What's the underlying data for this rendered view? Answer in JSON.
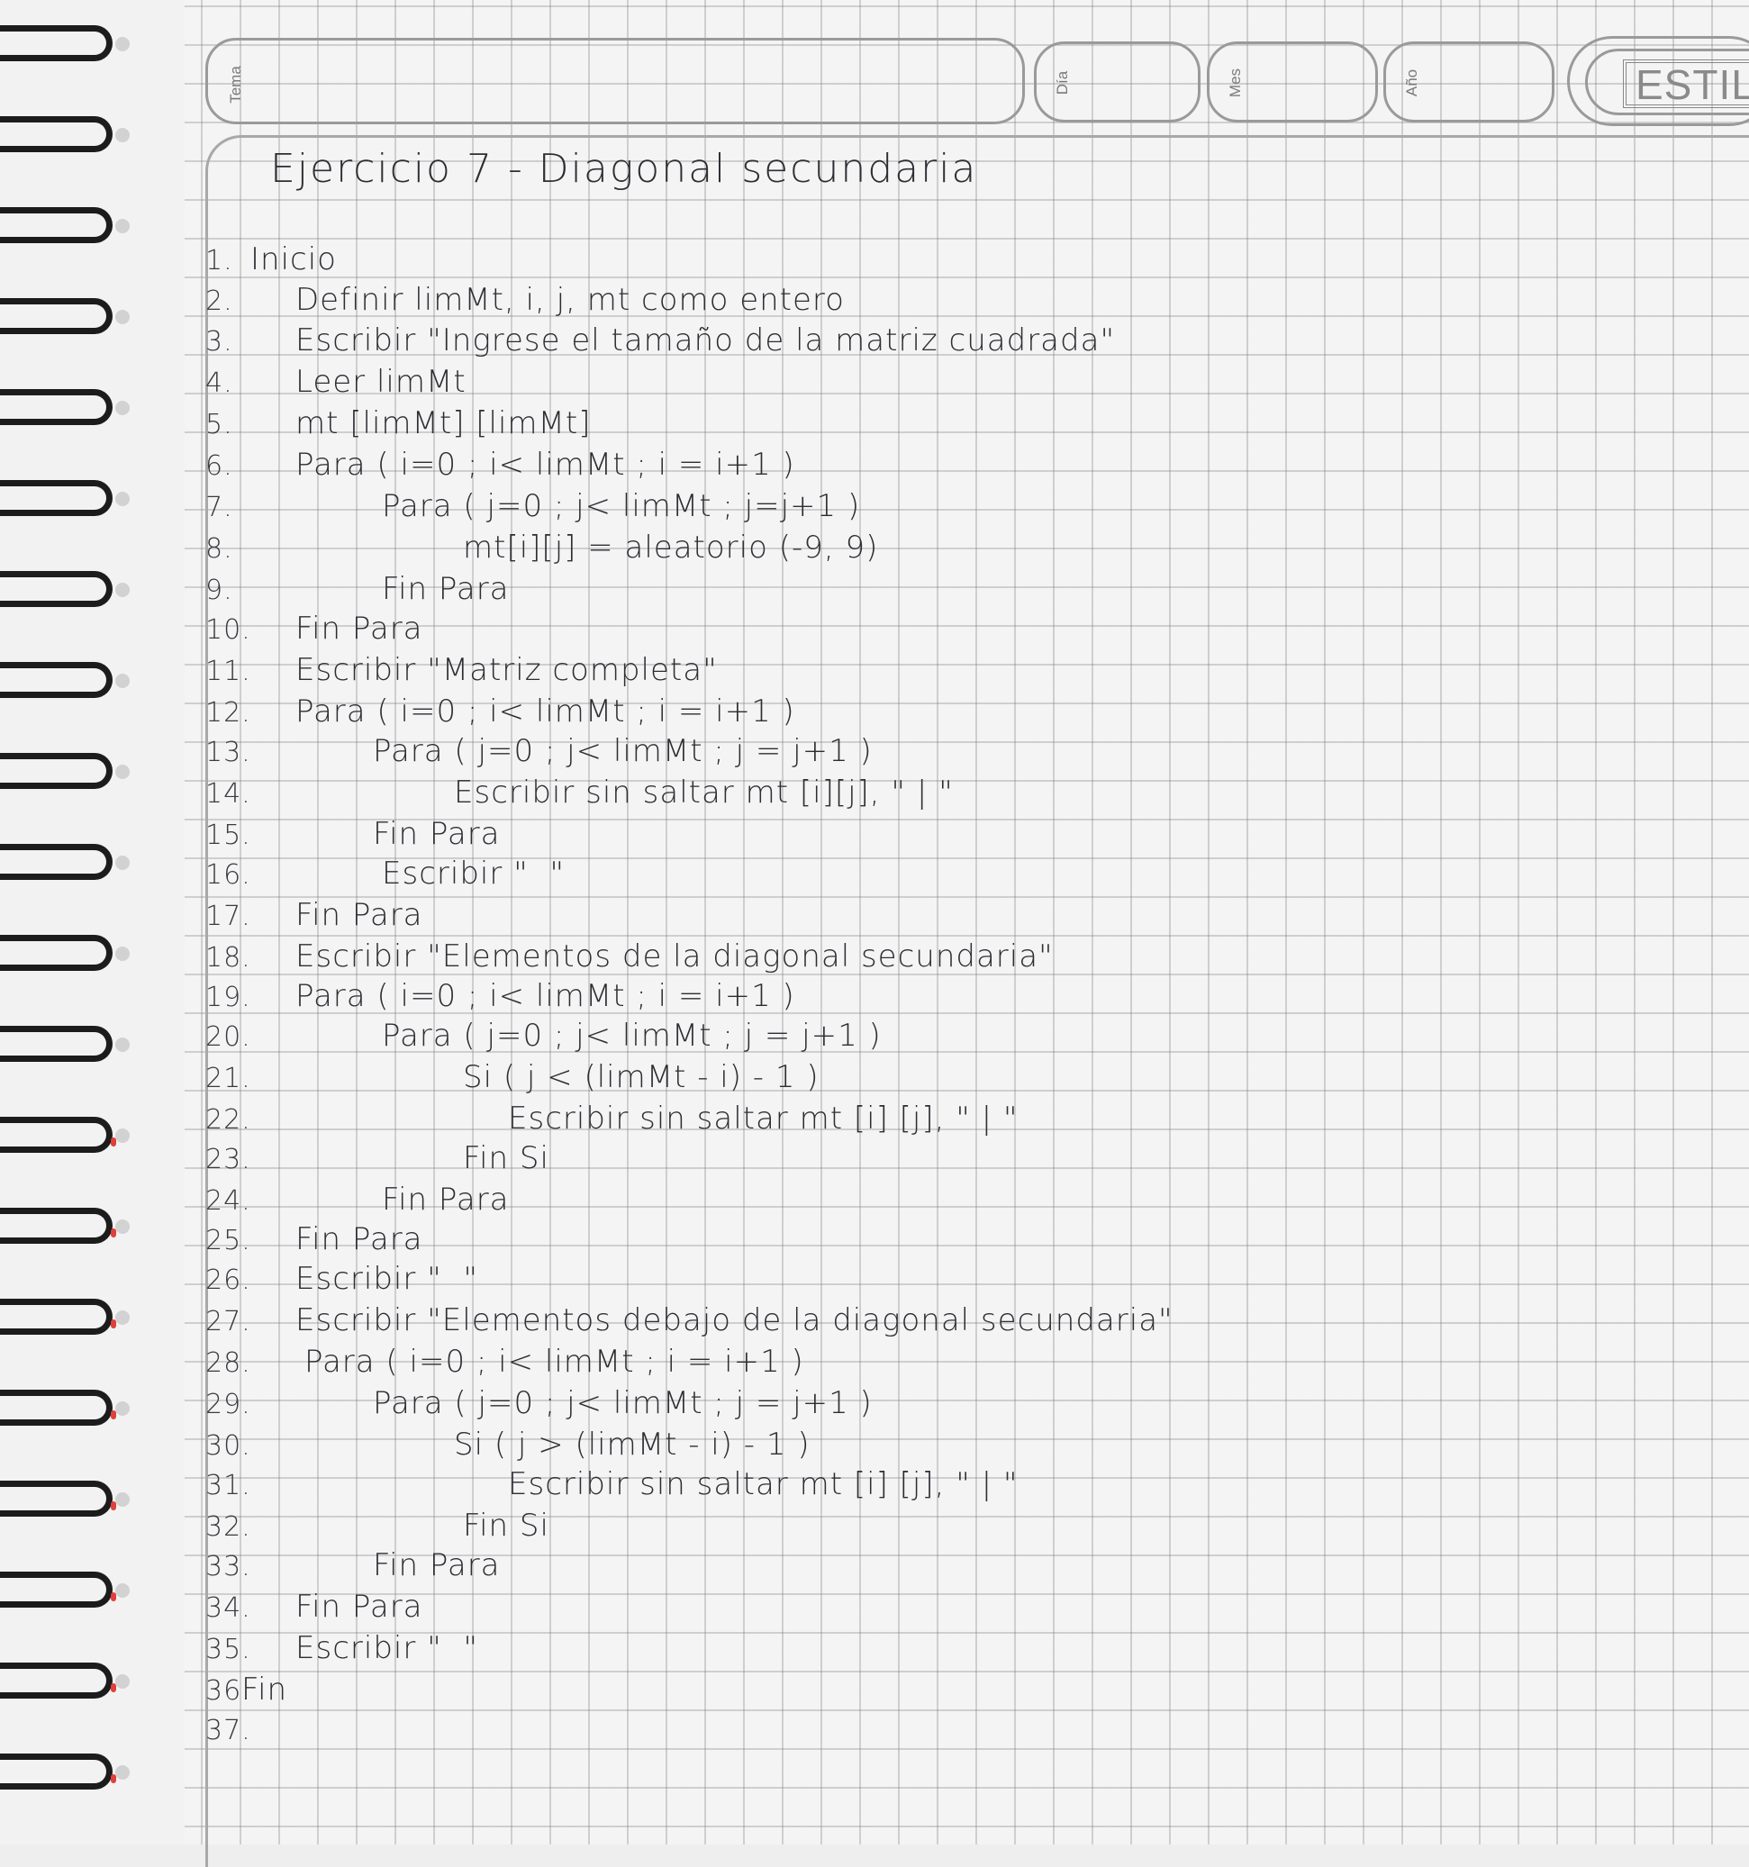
{
  "header": {
    "tema_label": "Tema",
    "dia_label": "Día",
    "mes_label": "Mes",
    "ano_label": "Año",
    "brand": "ESTILO"
  },
  "title": "Ejercicio 7 - Diagonal secundaria",
  "lines": [
    {
      "n": "1.",
      "text": "Inicio"
    },
    {
      "n": "2.",
      "text": "Definir limMt, i, j, mt como entero"
    },
    {
      "n": "3.",
      "text": "Escribir \"Ingrese el tamaño de la matriz cuadrada\""
    },
    {
      "n": "4.",
      "text": "Leer limMt"
    },
    {
      "n": "5.",
      "text": "mt [limMt] [limMt]"
    },
    {
      "n": "6.",
      "text": "Para ( i=0 ; i< limMt ; i = i+1 )"
    },
    {
      "n": "7.",
      "text": "Para ( j=0 ; j< limMt ; j=j+1 )"
    },
    {
      "n": "8.",
      "text": "mt[i][j] = aleatorio (-9, 9)"
    },
    {
      "n": "9.",
      "text": "Fin Para"
    },
    {
      "n": "10.",
      "text": "Fin Para"
    },
    {
      "n": "11.",
      "text": "Escribir \"Matriz completa\""
    },
    {
      "n": "12.",
      "text": "Para ( i=0 ; i< limMt ; i = i+1 )"
    },
    {
      "n": "13.",
      "text": "Para ( j=0 ; j< limMt ; j = j+1 )"
    },
    {
      "n": "14.",
      "text": "Escribir sin saltar mt [i][j], \" | \""
    },
    {
      "n": "15.",
      "text": "Fin Para"
    },
    {
      "n": "16.",
      "text": "Escribir \"  \""
    },
    {
      "n": "17.",
      "text": "Fin Para"
    },
    {
      "n": "18.",
      "text": "Escribir \"Elementos de la diagonal secundaria\""
    },
    {
      "n": "19.",
      "text": "Para ( i=0 ; i< limMt ; i = i+1 )"
    },
    {
      "n": "20.",
      "text": "Para ( j=0 ; j< limMt ; j = j+1 )"
    },
    {
      "n": "21.",
      "text": "Si ( j < (limMt - i) - 1 )"
    },
    {
      "n": "22.",
      "text": "Escribir sin saltar mt [i] [j], \" | \""
    },
    {
      "n": "23.",
      "text": "Fin Si"
    },
    {
      "n": "24.",
      "text": "Fin Para"
    },
    {
      "n": "25.",
      "text": "Fin Para"
    },
    {
      "n": "26.",
      "text": "Escribir \"  \""
    },
    {
      "n": "27.",
      "text": "Escribir \"Elementos debajo de la diagonal secundaria\""
    },
    {
      "n": "28.",
      "text": "Para ( i=0 ; i< limMt ; i = i+1 )"
    },
    {
      "n": "29.",
      "text": "Para ( j=0 ; j< limMt ; j = j+1 )"
    },
    {
      "n": "30.",
      "text": "Si ( j > (limMt - i) - 1 )"
    },
    {
      "n": "31.",
      "text": "Escribir sin saltar mt [i] [j], \" | \""
    },
    {
      "n": "32.",
      "text": "Fin Si"
    },
    {
      "n": "33.",
      "text": "Fin Para"
    },
    {
      "n": "34.",
      "text": "Fin Para"
    },
    {
      "n": "35.",
      "text": "Escribir \"  \""
    },
    {
      "n": "36.",
      "text": "Fin"
    },
    {
      "n": "37.",
      "text": ""
    }
  ]
}
